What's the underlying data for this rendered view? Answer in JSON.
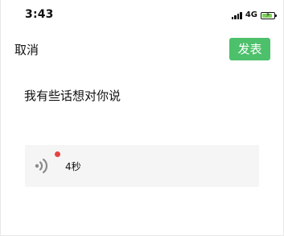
{
  "status_bar": {
    "time": "3:43",
    "network": "4G",
    "battery_charging": true,
    "colors": {
      "battery_fill": "#7ed05b"
    }
  },
  "nav": {
    "cancel_label": "取消",
    "publish_label": "发表",
    "colors": {
      "publish_bg": "#4cc06a",
      "publish_text": "#ffffff"
    }
  },
  "post": {
    "text": "我有些话想对你说"
  },
  "voice_message": {
    "icon": "voice-wave-icon",
    "unread": true,
    "duration": "4秒",
    "colors": {
      "card_bg": "#f5f5f5",
      "unread_dot": "#e64340"
    }
  }
}
